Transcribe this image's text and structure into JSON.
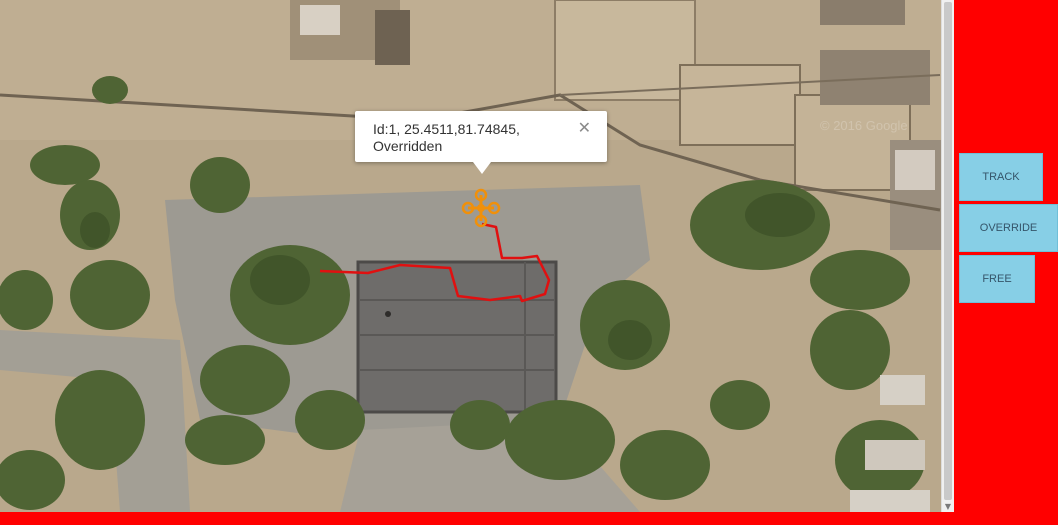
{
  "map": {
    "imagery": "satellite",
    "popup": {
      "line1": "Id:1, 25.4511,81.74845,",
      "line2": "Overridden",
      "close_glyph": "✕"
    },
    "track_color": "#e01010",
    "marker_icon": "drone-icon",
    "marker_color": "#f0900a",
    "watermark": "© 2016 Google"
  },
  "controls": {
    "track_label": "TRACK",
    "override_label": "OVERRIDE",
    "free_label": "FREE"
  },
  "colors": {
    "frame": "#ff0000",
    "button_bg": "#87cfe6",
    "button_text": "#35556a"
  }
}
